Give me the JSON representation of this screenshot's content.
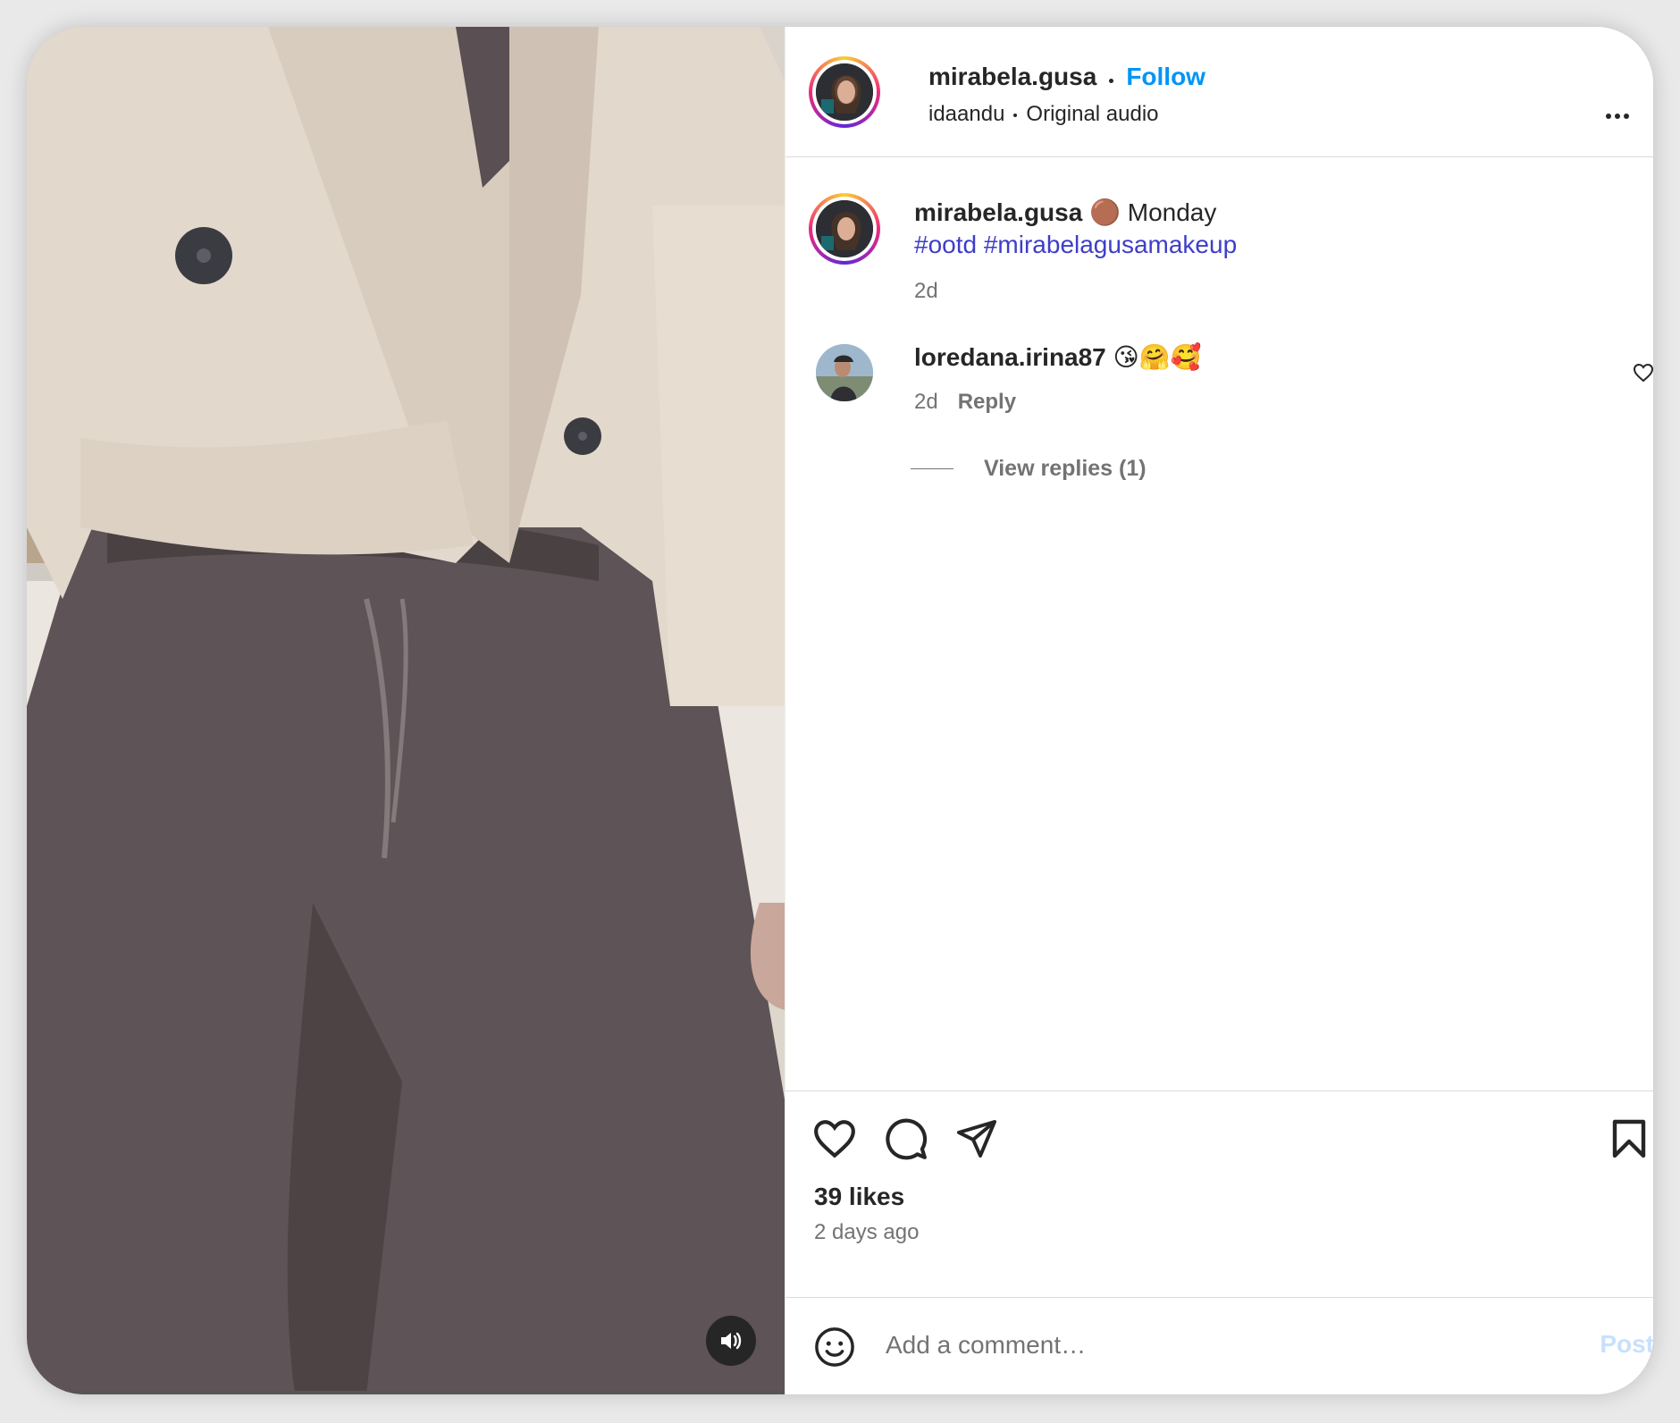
{
  "post": {
    "author": "mirabela.gusa",
    "follow_label": "Follow",
    "audio_author": "idaandu",
    "audio_title": "Original audio",
    "more_icon": "more-horizontal-icon"
  },
  "caption": {
    "author": "mirabela.gusa",
    "emoji": "🟤",
    "text": "Monday",
    "hashtags": [
      "#ootd",
      "#mirabelagusamakeup"
    ],
    "age": "2d"
  },
  "comments": [
    {
      "author": "loredana.irina87",
      "text": "😘🤗🥰",
      "age": "2d",
      "reply_label": "Reply",
      "view_replies_label": "View replies (1)"
    }
  ],
  "actions": {
    "like_icon": "heart-outline-icon",
    "comment_icon": "speech-bubble-icon",
    "share_icon": "paper-plane-icon",
    "save_icon": "bookmark-icon"
  },
  "stats": {
    "likes": "39 likes",
    "posted": "2 days ago"
  },
  "composer": {
    "placeholder": "Add a comment…",
    "post_label": "Post",
    "emoji_icon": "smiley-face-icon"
  },
  "video": {
    "mute_icon": "speaker-icon"
  },
  "colors": {
    "accent": "#0095f6",
    "hashtag": "#3e3ec9",
    "text": "#262626",
    "muted": "#737373"
  }
}
